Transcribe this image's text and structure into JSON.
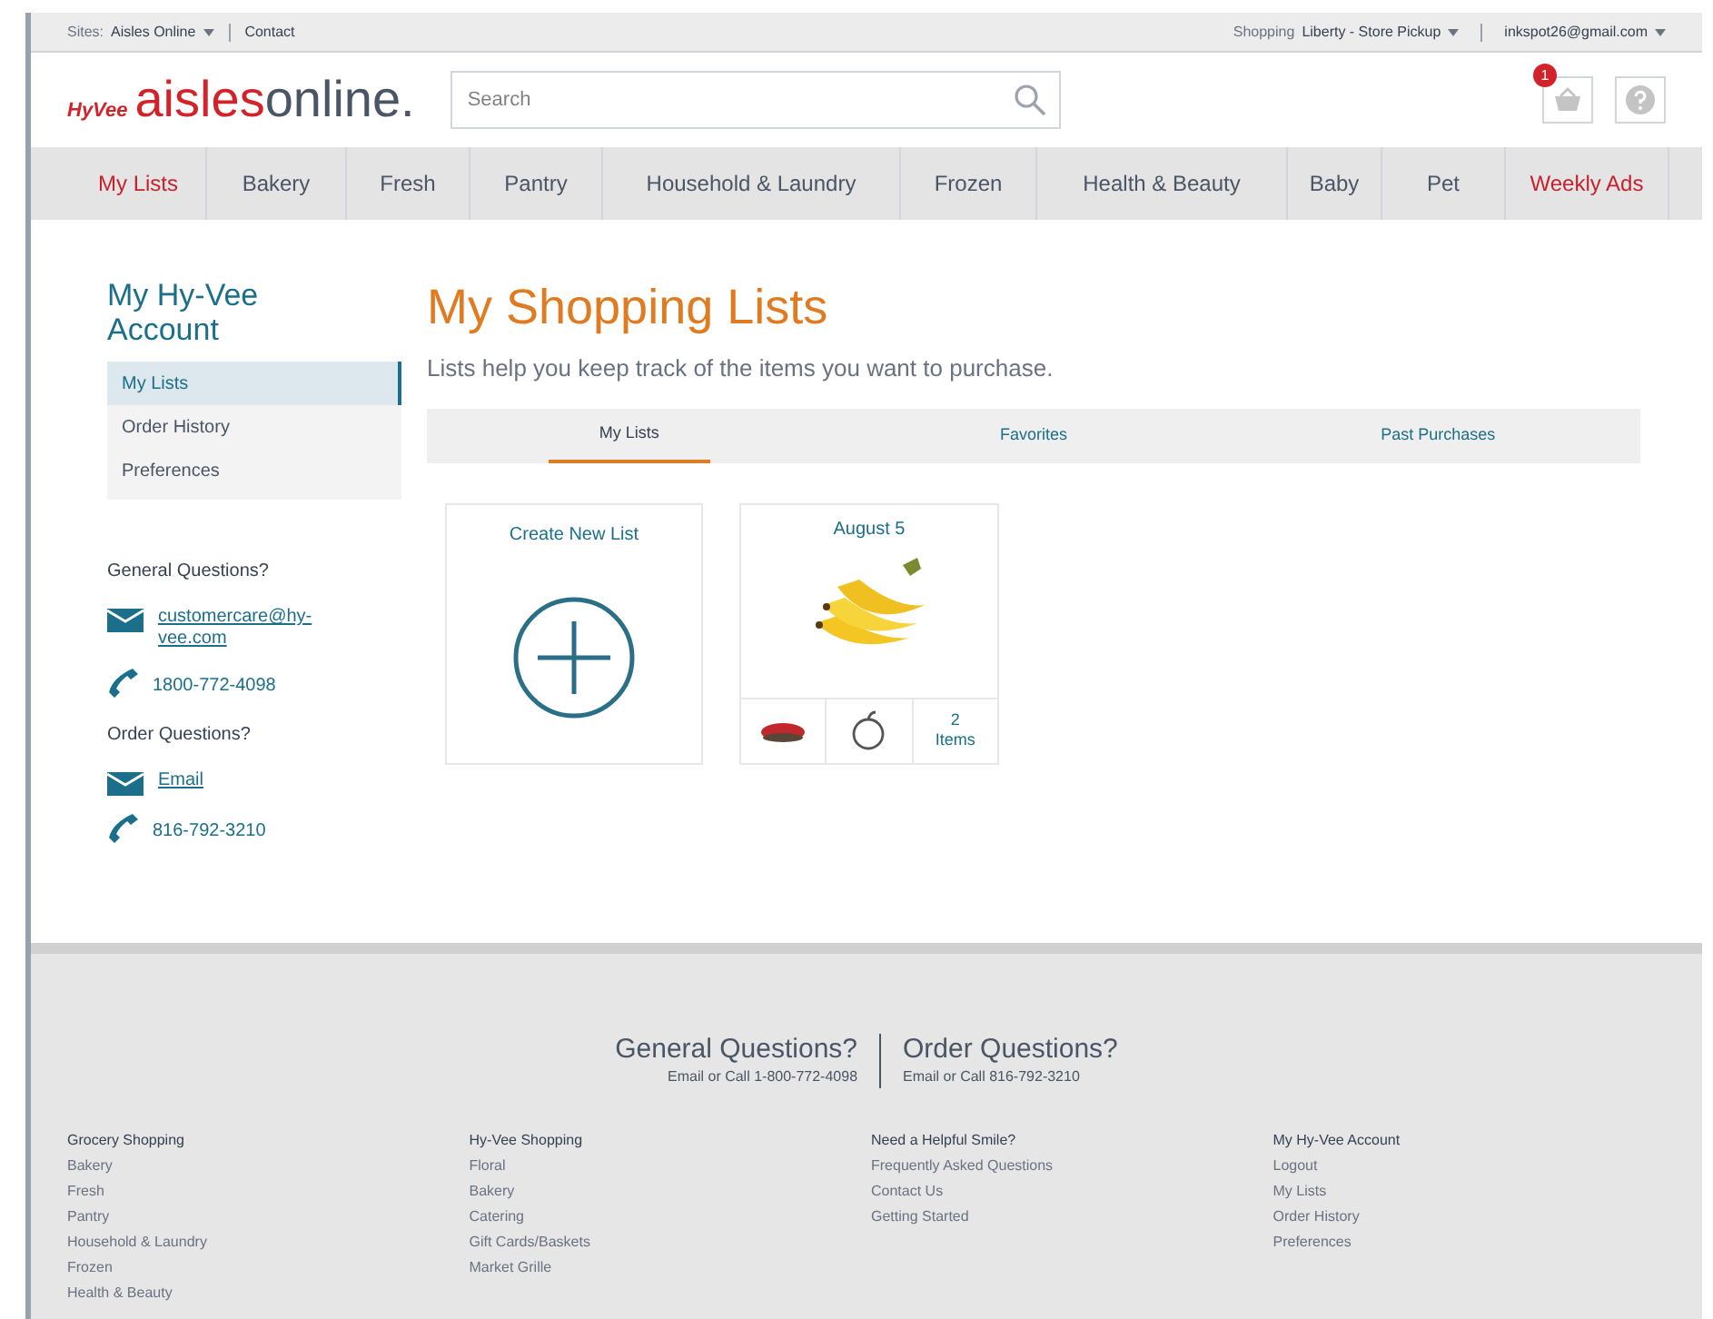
{
  "top_bar": {
    "sites_label": "Sites:",
    "site": "Aisles Online",
    "contact": "Contact",
    "shopping_label": "Shopping",
    "store": "Liberty - Store Pickup",
    "account": "inkspot26@gmail.com"
  },
  "header": {
    "logo_brand": "HyVee",
    "logo_name_a": "aisles",
    "logo_name_b": "online.",
    "search": {
      "placeholder": "Search"
    },
    "cart_count": "1"
  },
  "nav": [
    {
      "label": "My Lists",
      "highlighted": true
    },
    {
      "label": "Bakery",
      "highlighted": false
    },
    {
      "label": "Fresh",
      "highlighted": false
    },
    {
      "label": "Pantry",
      "highlighted": false
    },
    {
      "label": "Household & Laundry",
      "highlighted": false
    },
    {
      "label": "Frozen",
      "highlighted": false
    },
    {
      "label": "Health & Beauty",
      "highlighted": false
    },
    {
      "label": "Baby",
      "highlighted": false
    },
    {
      "label": "Pet",
      "highlighted": false
    },
    {
      "label": "Weekly Ads",
      "highlighted": true
    }
  ],
  "sidebar": {
    "title": "My Hy-Vee Account",
    "items": [
      {
        "label": "My Lists",
        "selected": true
      },
      {
        "label": "Order History",
        "selected": false
      },
      {
        "label": "Preferences",
        "selected": false
      }
    ],
    "contact_groups": [
      {
        "heading": "General Questions?",
        "entries": [
          {
            "kind": "email",
            "text": "customercare@hy-vee.com"
          },
          {
            "kind": "phone",
            "text": "1800-772-4098"
          }
        ]
      },
      {
        "heading": "Order Questions?",
        "entries": [
          {
            "kind": "email",
            "text": "Email"
          },
          {
            "kind": "phone",
            "text": "816-792-3210"
          }
        ]
      }
    ]
  },
  "main": {
    "title": "My Shopping Lists",
    "subtitle": "Lists help you keep track of the items you want to purchase.",
    "tabs": [
      {
        "label": "My Lists",
        "selected": true
      },
      {
        "label": "Favorites",
        "selected": false
      },
      {
        "label": "Past Purchases",
        "selected": false
      }
    ],
    "cards": [
      {
        "kind": "create",
        "label": "Create New List"
      },
      {
        "kind": "list",
        "title": "August 5",
        "count": "2",
        "count_label": "Items"
      }
    ]
  },
  "footer": {
    "contact": [
      {
        "heading": "General Questions?",
        "line": "Email or Call 1-800-772-4098"
      },
      {
        "heading": "Order Questions?",
        "line": "Email or Call 816-792-3210"
      }
    ],
    "columns": [
      {
        "heading": "Grocery Shopping",
        "links": [
          "Bakery",
          "Fresh",
          "Pantry",
          "Household & Laundry",
          "Frozen",
          "Health & Beauty"
        ]
      },
      {
        "heading": "Hy-Vee Shopping",
        "links": [
          "Floral",
          "Bakery",
          "Catering",
          "Gift Cards/Baskets",
          "Market Grille"
        ]
      },
      {
        "heading": "Need a Helpful Smile?",
        "links": [
          "Frequently Asked Questions",
          "Contact Us",
          "Getting Started"
        ]
      },
      {
        "heading": "My Hy-Vee Account",
        "links": [
          "Logout",
          "My Lists",
          "Order History",
          "Preferences"
        ]
      }
    ]
  }
}
